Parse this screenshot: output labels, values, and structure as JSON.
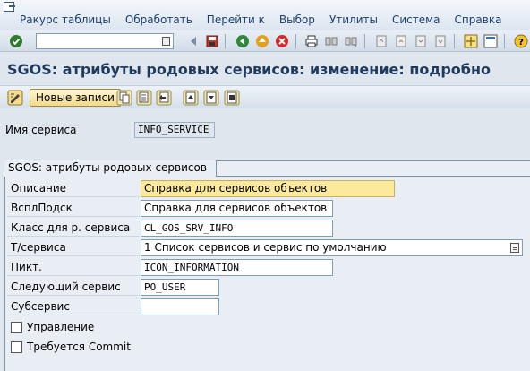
{
  "menubar": {
    "items": [
      "Ракурс таблицы",
      "Обработать",
      "Перейти к",
      "Выбор",
      "Утилиты",
      "Система",
      "Справка"
    ]
  },
  "toolbar": {
    "command_field_value": "",
    "icons": [
      "enter-icon",
      "back-icon",
      "exit-icon",
      "cancel-icon",
      "print-icon",
      "find-icon",
      "find-next-icon",
      "first-page-icon",
      "prev-page-icon",
      "next-page-icon",
      "last-page-icon",
      "new-session-icon",
      "shortcut-icon",
      "help-icon"
    ]
  },
  "title": "SGOS: атрибуты родовых сервисов: изменение: подробно",
  "app_toolbar": {
    "new_entries_label": "Новые записи"
  },
  "service": {
    "label": "Имя сервиса",
    "value": "INFO_SERVICE"
  },
  "group": {
    "title": "SGOS: атрибуты родовых сервисов",
    "fields": [
      {
        "label": "Описание",
        "value": "Справка для сервисов объектов"
      },
      {
        "label": "ВсплПодск",
        "value": "Справка для сервисов объектов"
      },
      {
        "label": "Класс для р. сервиса",
        "value": "CL_GOS_SRV_INFO"
      },
      {
        "label": "Т/сервиса",
        "value": "1 Список сервисов и сервис по умолчанию"
      },
      {
        "label": "Пикт.",
        "value": "ICON_INFORMATION"
      },
      {
        "label": "Следующий сервис",
        "value": "PO_USER"
      },
      {
        "label": "Субсервис",
        "value": ""
      }
    ],
    "checkboxes": [
      {
        "label": "Управление",
        "checked": false
      },
      {
        "label": "Требуется Commit",
        "checked": false
      }
    ]
  }
}
